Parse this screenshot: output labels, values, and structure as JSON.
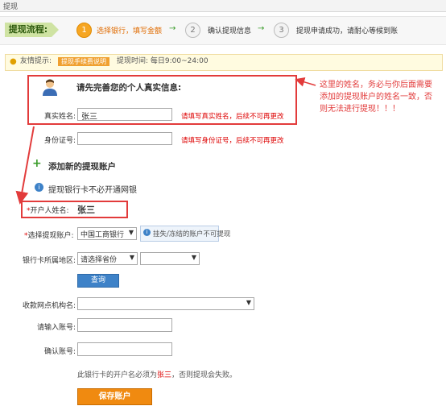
{
  "tab": {
    "label": "提现"
  },
  "flow": {
    "label": "提现流程:",
    "steps": [
      {
        "num": "1",
        "text": "选择银行，填写金额"
      },
      {
        "num": "2",
        "text": "确认提现信息"
      },
      {
        "num": "3",
        "text": "提现申请成功，请耐心等候到账"
      }
    ],
    "arrow": "→"
  },
  "tip": {
    "prefix": "友情提示:",
    "link": "提现手续费说明",
    "time": "提现时间: 每日9:00~24:00"
  },
  "profile": {
    "title": "请先完善您的个人真实信息:",
    "real_name_label": "真实姓名:",
    "real_name_value": "张三",
    "real_name_hint": "请填写真实姓名，后续不可再更改",
    "id_label": "身份证号:",
    "id_value": "",
    "id_hint": "请填写身份证号，后续不可再更改"
  },
  "account": {
    "title": "添加新的提现账户",
    "note": "提现银行卡不必开通网银",
    "holder_label": "开户人姓名:",
    "holder_value": "张三",
    "bank_label": "选择提现账户:",
    "bank_value": "中国工商银行",
    "bank_note": "挂失/冻结的账户不可提现",
    "region_label": "银行卡所属地区:",
    "province_value": "请选择省份",
    "city_value": "",
    "query_button": "查询",
    "branch_label": "收款网点机构名:",
    "branch_value": "",
    "account_label": "请输入账号:",
    "confirm_label": "确认账号:",
    "footnote_before": "此银行卡的开户名必须为",
    "footnote_name": "张三",
    "footnote_after": "，否则提现会失败。",
    "save_button": "保存账户"
  },
  "annotation": {
    "line1": "这里的姓名，务必与你后面需要",
    "line2": "添加的提现账户的姓名一致，否",
    "line3": "则无法进行提现！！！"
  },
  "colors": {
    "annotation_red": "#e23b3b",
    "step_active": "#f6a623",
    "flow_green": "#3a9c2a"
  }
}
